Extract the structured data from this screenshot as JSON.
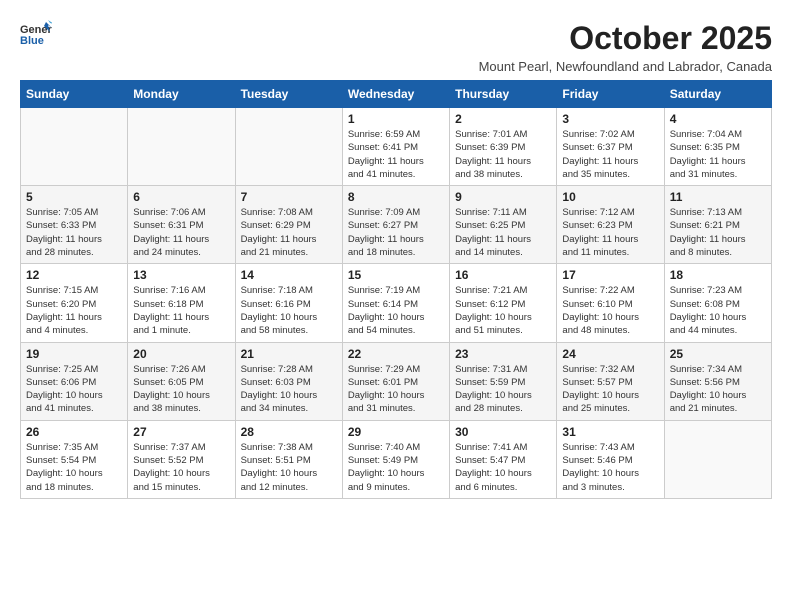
{
  "header": {
    "logo_general": "General",
    "logo_blue": "Blue",
    "month": "October 2025",
    "location": "Mount Pearl, Newfoundland and Labrador, Canada"
  },
  "days_of_week": [
    "Sunday",
    "Monday",
    "Tuesday",
    "Wednesday",
    "Thursday",
    "Friday",
    "Saturday"
  ],
  "weeks": [
    [
      {
        "day": "",
        "info": ""
      },
      {
        "day": "",
        "info": ""
      },
      {
        "day": "",
        "info": ""
      },
      {
        "day": "1",
        "info": "Sunrise: 6:59 AM\nSunset: 6:41 PM\nDaylight: 11 hours\nand 41 minutes."
      },
      {
        "day": "2",
        "info": "Sunrise: 7:01 AM\nSunset: 6:39 PM\nDaylight: 11 hours\nand 38 minutes."
      },
      {
        "day": "3",
        "info": "Sunrise: 7:02 AM\nSunset: 6:37 PM\nDaylight: 11 hours\nand 35 minutes."
      },
      {
        "day": "4",
        "info": "Sunrise: 7:04 AM\nSunset: 6:35 PM\nDaylight: 11 hours\nand 31 minutes."
      }
    ],
    [
      {
        "day": "5",
        "info": "Sunrise: 7:05 AM\nSunset: 6:33 PM\nDaylight: 11 hours\nand 28 minutes."
      },
      {
        "day": "6",
        "info": "Sunrise: 7:06 AM\nSunset: 6:31 PM\nDaylight: 11 hours\nand 24 minutes."
      },
      {
        "day": "7",
        "info": "Sunrise: 7:08 AM\nSunset: 6:29 PM\nDaylight: 11 hours\nand 21 minutes."
      },
      {
        "day": "8",
        "info": "Sunrise: 7:09 AM\nSunset: 6:27 PM\nDaylight: 11 hours\nand 18 minutes."
      },
      {
        "day": "9",
        "info": "Sunrise: 7:11 AM\nSunset: 6:25 PM\nDaylight: 11 hours\nand 14 minutes."
      },
      {
        "day": "10",
        "info": "Sunrise: 7:12 AM\nSunset: 6:23 PM\nDaylight: 11 hours\nand 11 minutes."
      },
      {
        "day": "11",
        "info": "Sunrise: 7:13 AM\nSunset: 6:21 PM\nDaylight: 11 hours\nand 8 minutes."
      }
    ],
    [
      {
        "day": "12",
        "info": "Sunrise: 7:15 AM\nSunset: 6:20 PM\nDaylight: 11 hours\nand 4 minutes."
      },
      {
        "day": "13",
        "info": "Sunrise: 7:16 AM\nSunset: 6:18 PM\nDaylight: 11 hours\nand 1 minute."
      },
      {
        "day": "14",
        "info": "Sunrise: 7:18 AM\nSunset: 6:16 PM\nDaylight: 10 hours\nand 58 minutes."
      },
      {
        "day": "15",
        "info": "Sunrise: 7:19 AM\nSunset: 6:14 PM\nDaylight: 10 hours\nand 54 minutes."
      },
      {
        "day": "16",
        "info": "Sunrise: 7:21 AM\nSunset: 6:12 PM\nDaylight: 10 hours\nand 51 minutes."
      },
      {
        "day": "17",
        "info": "Sunrise: 7:22 AM\nSunset: 6:10 PM\nDaylight: 10 hours\nand 48 minutes."
      },
      {
        "day": "18",
        "info": "Sunrise: 7:23 AM\nSunset: 6:08 PM\nDaylight: 10 hours\nand 44 minutes."
      }
    ],
    [
      {
        "day": "19",
        "info": "Sunrise: 7:25 AM\nSunset: 6:06 PM\nDaylight: 10 hours\nand 41 minutes."
      },
      {
        "day": "20",
        "info": "Sunrise: 7:26 AM\nSunset: 6:05 PM\nDaylight: 10 hours\nand 38 minutes."
      },
      {
        "day": "21",
        "info": "Sunrise: 7:28 AM\nSunset: 6:03 PM\nDaylight: 10 hours\nand 34 minutes."
      },
      {
        "day": "22",
        "info": "Sunrise: 7:29 AM\nSunset: 6:01 PM\nDaylight: 10 hours\nand 31 minutes."
      },
      {
        "day": "23",
        "info": "Sunrise: 7:31 AM\nSunset: 5:59 PM\nDaylight: 10 hours\nand 28 minutes."
      },
      {
        "day": "24",
        "info": "Sunrise: 7:32 AM\nSunset: 5:57 PM\nDaylight: 10 hours\nand 25 minutes."
      },
      {
        "day": "25",
        "info": "Sunrise: 7:34 AM\nSunset: 5:56 PM\nDaylight: 10 hours\nand 21 minutes."
      }
    ],
    [
      {
        "day": "26",
        "info": "Sunrise: 7:35 AM\nSunset: 5:54 PM\nDaylight: 10 hours\nand 18 minutes."
      },
      {
        "day": "27",
        "info": "Sunrise: 7:37 AM\nSunset: 5:52 PM\nDaylight: 10 hours\nand 15 minutes."
      },
      {
        "day": "28",
        "info": "Sunrise: 7:38 AM\nSunset: 5:51 PM\nDaylight: 10 hours\nand 12 minutes."
      },
      {
        "day": "29",
        "info": "Sunrise: 7:40 AM\nSunset: 5:49 PM\nDaylight: 10 hours\nand 9 minutes."
      },
      {
        "day": "30",
        "info": "Sunrise: 7:41 AM\nSunset: 5:47 PM\nDaylight: 10 hours\nand 6 minutes."
      },
      {
        "day": "31",
        "info": "Sunrise: 7:43 AM\nSunset: 5:46 PM\nDaylight: 10 hours\nand 3 minutes."
      },
      {
        "day": "",
        "info": ""
      }
    ]
  ]
}
